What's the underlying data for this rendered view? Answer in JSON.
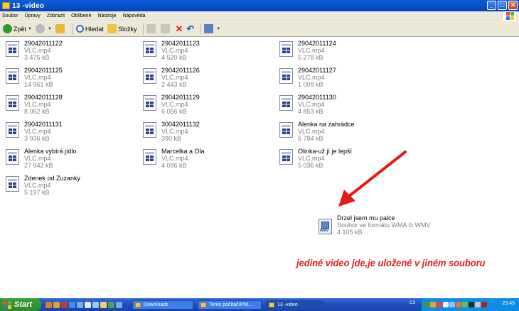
{
  "window": {
    "title": "13 -video",
    "min_label": "_",
    "max_label": "□",
    "close_label": "✕"
  },
  "menu": [
    "Soubor",
    "Úpravy",
    "Zobrazit",
    "Oblíbené",
    "Nástroje",
    "Nápověda"
  ],
  "toolbar": {
    "back_label": "Zpět",
    "search_label": "Hledat",
    "folders_label": "Složky"
  },
  "files": [
    {
      "name": "29042011122",
      "type": "VLC.mp4",
      "size": "3 475 kB"
    },
    {
      "name": "29042011123",
      "type": "VLC.mp4",
      "size": "4 520 kB"
    },
    {
      "name": "29042011124",
      "type": "VLC.mp4",
      "size": "5 278 kB"
    },
    {
      "name": "29042011125",
      "type": "VLC.mp4",
      "size": "14 961 kB"
    },
    {
      "name": "29042011126",
      "type": "VLC.mp4",
      "size": "2 443 kB"
    },
    {
      "name": "29042011127",
      "type": "VLC.mp4",
      "size": "1 008 kB"
    },
    {
      "name": "29042011128",
      "type": "VLC.mp4",
      "size": "8 062 kB"
    },
    {
      "name": "29042011129",
      "type": "VLC.mp4",
      "size": "6 056 kB"
    },
    {
      "name": "29042011130",
      "type": "VLC.mp4",
      "size": "4 853 kB"
    },
    {
      "name": "29042011131",
      "type": "VLC.mp4",
      "size": "3 936 kB"
    },
    {
      "name": "30042011132",
      "type": "VLC.mp4",
      "size": "390 kB"
    },
    {
      "name": "Alenka na zahrádce",
      "type": "VLC.mp4",
      "size": "6 784 kB"
    },
    {
      "name": "Alenka vybírá jídlo",
      "type": "VLC.mp4",
      "size": "27 942 kB"
    },
    {
      "name": "Marcelka a Ola",
      "type": "VLC.mp4",
      "size": "4 096 kB"
    },
    {
      "name": "Olinka-už jí je lepší",
      "type": "VLC.mp4",
      "size": "5 036 kB"
    },
    {
      "name": "Zdenek od Zuzanky",
      "type": "VLC.mp4",
      "size": "5 197 kB"
    }
  ],
  "wmv_file": {
    "name": "Drzel jsem mu palce",
    "type": "Soubor ve formátu WMA či WMV",
    "size": "4 105 kB",
    "icon_label": "WMV"
  },
  "annotation": {
    "text": "jediné video jde,je uložené v jiném souboru",
    "color": "#e02020"
  },
  "taskbar": {
    "start_label": "Start",
    "tasks": [
      "Downloads",
      "Tento počítač\\Phil...",
      "13 -video"
    ],
    "lang": "CS",
    "clock": "23:45"
  }
}
